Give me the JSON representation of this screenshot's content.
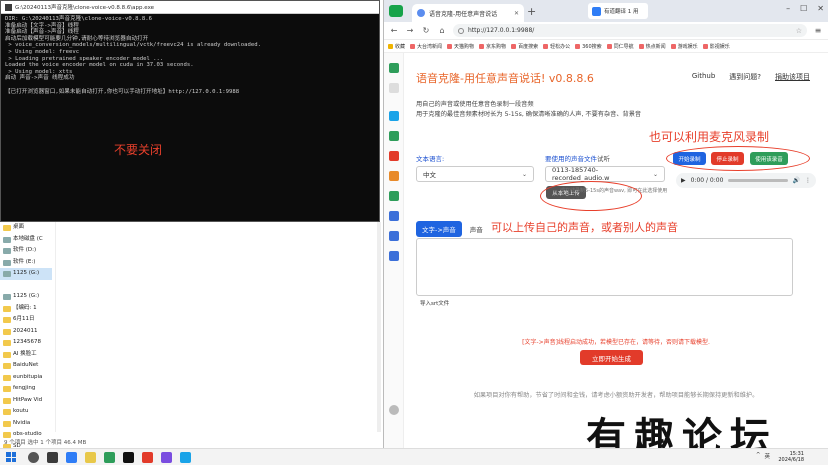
{
  "console": {
    "title": "G:\\20240113声音克隆\\clone-voice-v0.8.8.6\\app.exe",
    "lines": [
      "DIR: G:\\20240113声音克隆\\clone-voice-v0.8.8.6",
      "准备启动【文字->声音】线程",
      "准备启动【声音->声音】线程",
      "启动后加载模型可能要几分钟,请耐心等待浏览器自动打开",
      " > voice_conversion_models/multilingual/vctk/freevc24 is already downloaded.",
      " > Using model: freevc",
      " > Loading pretrained speaker encoder model ...",
      "Loaded the voice encoder model on cuda in 37.03 seconds.",
      " > Using model: xtts",
      "启动 声音->声音 线程成功",
      "",
      "【已打开浏览器窗口,如果未能自动打开,你也可以手动打开地址】http://127.0.0.1:9988"
    ],
    "note": "不要关闭"
  },
  "explorer": {
    "tree": [
      {
        "label": "桌面",
        "type": "folder"
      },
      {
        "label": "本地磁盘 (C",
        "type": "drive"
      },
      {
        "label": "软件 (D:)",
        "type": "drive"
      },
      {
        "label": "软件 (E:)",
        "type": "drive"
      },
      {
        "label": "1125 (G:)",
        "type": "drive",
        "selected": true
      },
      {
        "label": "",
        "type": "none"
      },
      {
        "label": "1125 (G:)",
        "type": "drive"
      },
      {
        "label": "【编码: 1",
        "type": "folder"
      },
      {
        "label": "6月11日",
        "type": "folder"
      },
      {
        "label": "2024011",
        "type": "folder"
      },
      {
        "label": "12345678",
        "type": "folder"
      },
      {
        "label": "AI 换脸工",
        "type": "folder"
      },
      {
        "label": "BaiduNet",
        "type": "folder"
      },
      {
        "label": "eunbitupia",
        "type": "folder"
      },
      {
        "label": "fengjing",
        "type": "folder"
      },
      {
        "label": "HitPaw Vid",
        "type": "folder"
      },
      {
        "label": "koutu",
        "type": "folder"
      },
      {
        "label": "Nvidia",
        "type": "folder"
      },
      {
        "label": "obs-studio",
        "type": "folder"
      },
      {
        "label": "SD",
        "type": "folder"
      },
      {
        "label": "Swap_Out",
        "type": "folder"
      }
    ],
    "status": "9 个项目  选中 1 个项目 46.4 MB"
  },
  "browser": {
    "tab_title": "语音克隆-用任意声音说话",
    "translate_label": "有道翻译 1 用",
    "url": "http://127.0.0.1:9988/",
    "bookmarks": [
      "收藏",
      "大台湾新闻",
      "天猫购物",
      "京东购物",
      "百度搜索",
      "轻松办公",
      "360搜索",
      "同仁导航",
      "热点新闻",
      "游戏娱乐",
      "影视娱乐"
    ]
  },
  "app": {
    "title": "语音克隆-用任意声音说话! v0.8.8.6",
    "links": [
      "Github",
      "遇到问题?",
      "捐助该项目"
    ],
    "desc1": "用自己的声音或使用任意音色录制一段音频",
    "desc2": "用于克隆的最佳音频素材时长为 5-15s, 确保清晰准确的人声, 不要有杂音、背景音",
    "annot_mic": "也可以利用麦克风录制",
    "text_lang_label": "文本语言:",
    "text_lang_value": "中文",
    "voice_file_label": "要使用的声音文件",
    "voice_file_suffix": "试听",
    "voice_file_value": "0113-185740-recorded_audio.w",
    "upload_btn": "从本地上传",
    "upload_hint": "或在线录制5-15s的声音wav, 即可在此选择使用",
    "record_start": "开始录制",
    "record_stop": "停止录制",
    "use_recording": "使用该录音",
    "audio_time": "0:00 / 0:00",
    "tab_text2voice": "文字->声音",
    "tab_voice2voice": "声音",
    "annot_upload": "可以上传自己的声音，或者别人的声音",
    "srt_label": "导入srt文件",
    "warning": "[文字->声音]线程启动成功，若模型已存在，请等待，否则请下载模型.",
    "generate_btn": "立即开始生成",
    "footer": "如果项目对你有帮助，节省了时间和金钱，请考虑小额资助开发者，帮助项目能够长期保持更新和维护。"
  },
  "watermark": "有趣论坛",
  "taskbar": {
    "tray": "英",
    "time": "15:31",
    "date": "2024/6/18"
  },
  "colors": {
    "accent_orange": "#e8652a",
    "annotation_red": "#e8402c",
    "primary_blue": "#1f64e0",
    "danger_red": "#e23b2a",
    "success_green": "#2e9d5a"
  }
}
